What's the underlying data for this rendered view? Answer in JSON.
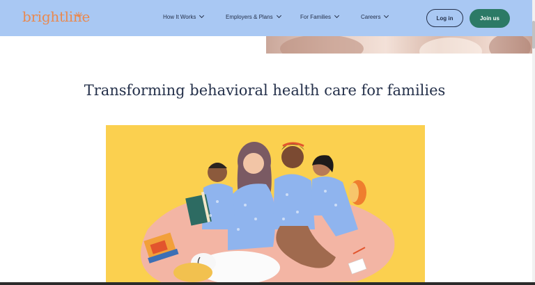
{
  "header": {
    "logo_text": "brightline",
    "nav": [
      {
        "label": "How It Works"
      },
      {
        "label": "Employers & Plans"
      },
      {
        "label": "For Families"
      },
      {
        "label": "Careers"
      }
    ],
    "login_label": "Log in",
    "join_label": "Join us"
  },
  "main": {
    "headline": "Transforming behavioral health care for families"
  },
  "colors": {
    "header_bg": "#a9c8f3",
    "brand_orange": "#e9894f",
    "join_green": "#2c7a66",
    "text_navy": "#24304a",
    "illustration_bg": "#fbd04f"
  }
}
